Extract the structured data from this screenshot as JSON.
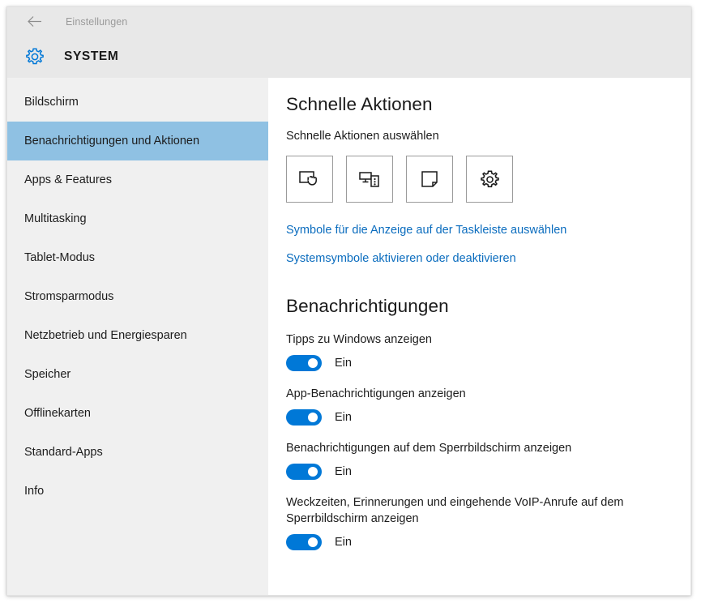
{
  "window": {
    "titlebar": {
      "back_icon": "back-arrow-icon",
      "label": "Einstellungen"
    },
    "header": {
      "icon": "gear-icon",
      "title": "SYSTEM"
    }
  },
  "sidebar": {
    "items": [
      {
        "label": "Bildschirm",
        "selected": false
      },
      {
        "label": "Benachrichtigungen und Aktionen",
        "selected": true
      },
      {
        "label": "Apps & Features",
        "selected": false
      },
      {
        "label": "Multitasking",
        "selected": false
      },
      {
        "label": "Tablet-Modus",
        "selected": false
      },
      {
        "label": "Stromsparmodus",
        "selected": false
      },
      {
        "label": "Netzbetrieb und Energiesparen",
        "selected": false
      },
      {
        "label": "Speicher",
        "selected": false
      },
      {
        "label": "Offlinekarten",
        "selected": false
      },
      {
        "label": "Standard-Apps",
        "selected": false
      },
      {
        "label": "Info",
        "selected": false
      }
    ]
  },
  "main": {
    "quick_actions": {
      "title": "Schnelle Aktionen",
      "subtitle": "Schnelle Aktionen auswählen",
      "tiles": [
        {
          "icon": "tablet-mode-icon"
        },
        {
          "icon": "connect-display-icon"
        },
        {
          "icon": "note-icon"
        },
        {
          "icon": "settings-gear-icon"
        }
      ],
      "links": [
        "Symbole für die Anzeige auf der Taskleiste auswählen",
        "Systemsymbole aktivieren oder deaktivieren"
      ]
    },
    "notifications": {
      "title": "Benachrichtigungen",
      "settings": [
        {
          "label": "Tipps zu Windows anzeigen",
          "state": "Ein",
          "on": true
        },
        {
          "label": "App-Benachrichtigungen anzeigen",
          "state": "Ein",
          "on": true
        },
        {
          "label": "Benachrichtigungen auf dem Sperrbildschirm anzeigen",
          "state": "Ein",
          "on": true
        },
        {
          "label": "Weckzeiten, Erinnerungen und eingehende VoIP-Anrufe auf dem Sperrbildschirm anzeigen",
          "state": "Ein",
          "on": true
        }
      ]
    }
  },
  "colors": {
    "accent": "#0078d7",
    "link": "#0a6cbe",
    "selection": "#8fc1e3",
    "sidebar_bg": "#f0f0f0",
    "titlebar_bg": "#e8e8e8"
  }
}
